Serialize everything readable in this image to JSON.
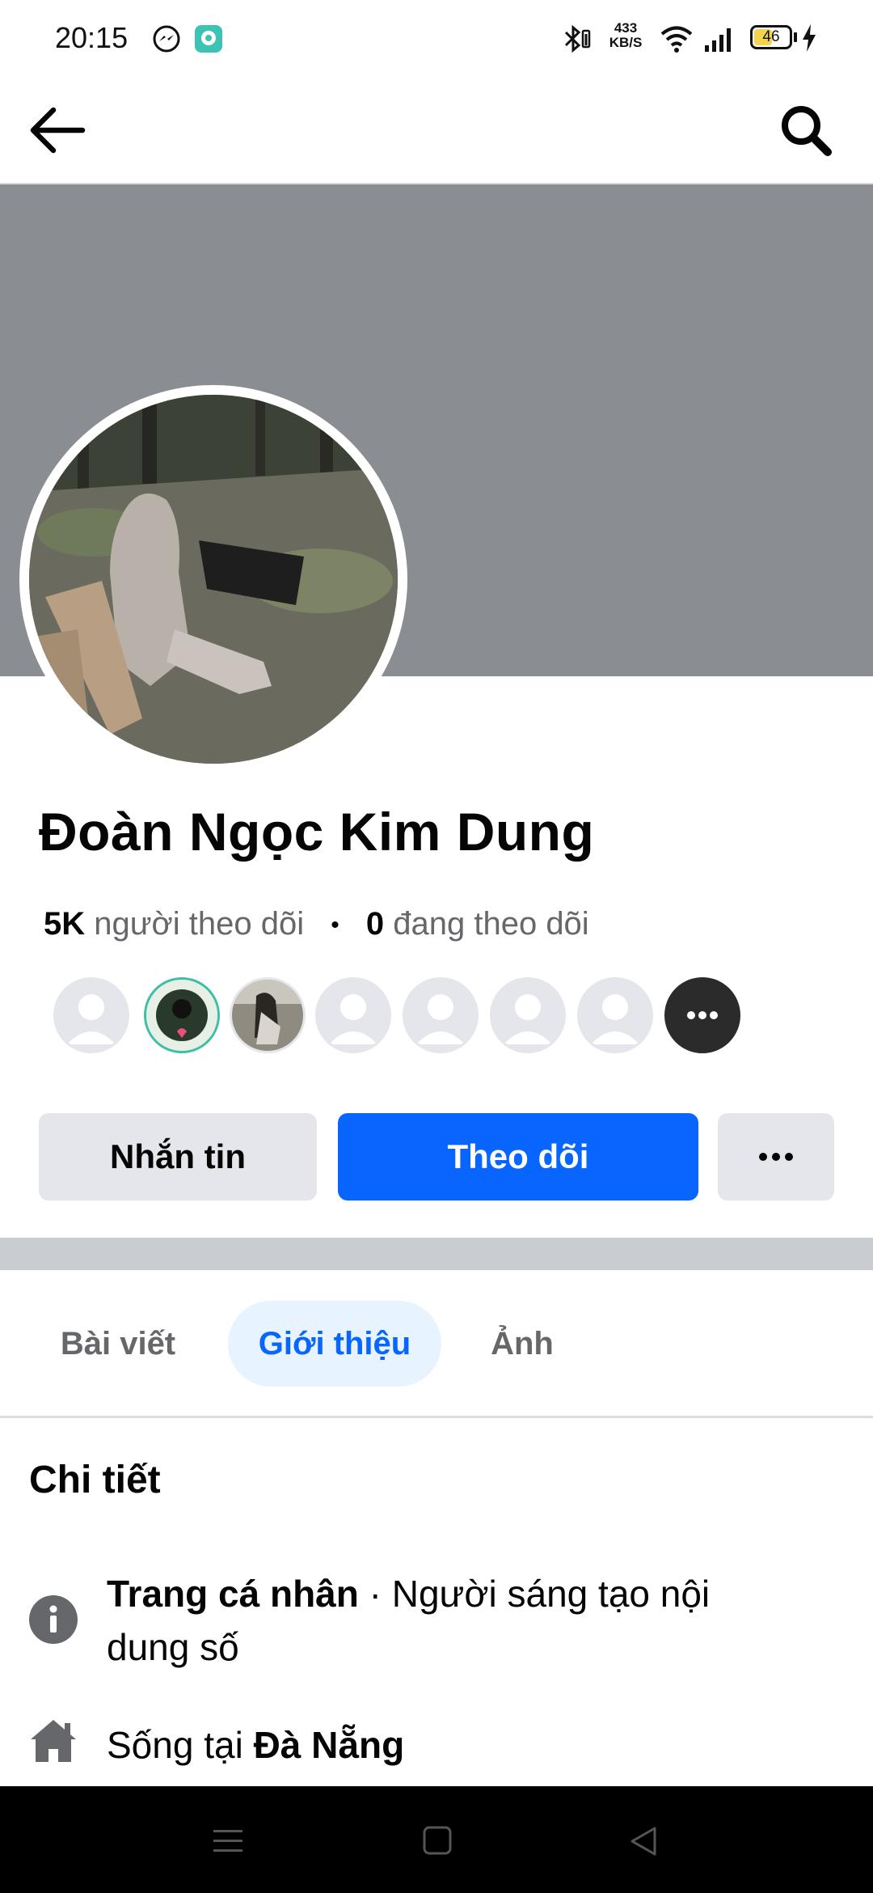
{
  "status_bar": {
    "time": "20:15",
    "net_speed_value": "433",
    "net_speed_unit": "KB/S",
    "battery": "46",
    "icons": [
      "messenger-icon",
      "app-notification-icon",
      "bluetooth-icon",
      "wifi-icon",
      "signal-icon",
      "battery-icon",
      "charging-icon"
    ]
  },
  "top_bar": {
    "icons": [
      "back-arrow-icon",
      "search-icon"
    ]
  },
  "profile": {
    "name": "Đoàn Ngọc Kim Dung",
    "followers_count": "5K",
    "followers_label": "người theo dõi",
    "separator": "•",
    "following_count": "0",
    "following_label": "đang theo dõi"
  },
  "actions": {
    "message": "Nhắn tin",
    "follow": "Theo dõi",
    "more_icon": "more-dots-icon"
  },
  "tabs": [
    {
      "label": "Bài viết",
      "active": false
    },
    {
      "label": "Giới thiệu",
      "active": true
    },
    {
      "label": "Ảnh",
      "active": false
    }
  ],
  "details": {
    "title": "Chi tiết",
    "page_label": "Trang cá nhân",
    "page_sep": " · ",
    "page_category": "Người sáng tạo nội dung số",
    "lives_prefix": "Sống tại ",
    "lives_city": "Đà Nẵng"
  },
  "colors": {
    "accent": "#0866ff",
    "cover": "#8a8d91",
    "button_grey": "#e4e6eb",
    "tab_active_bg": "#e7f3ff"
  }
}
